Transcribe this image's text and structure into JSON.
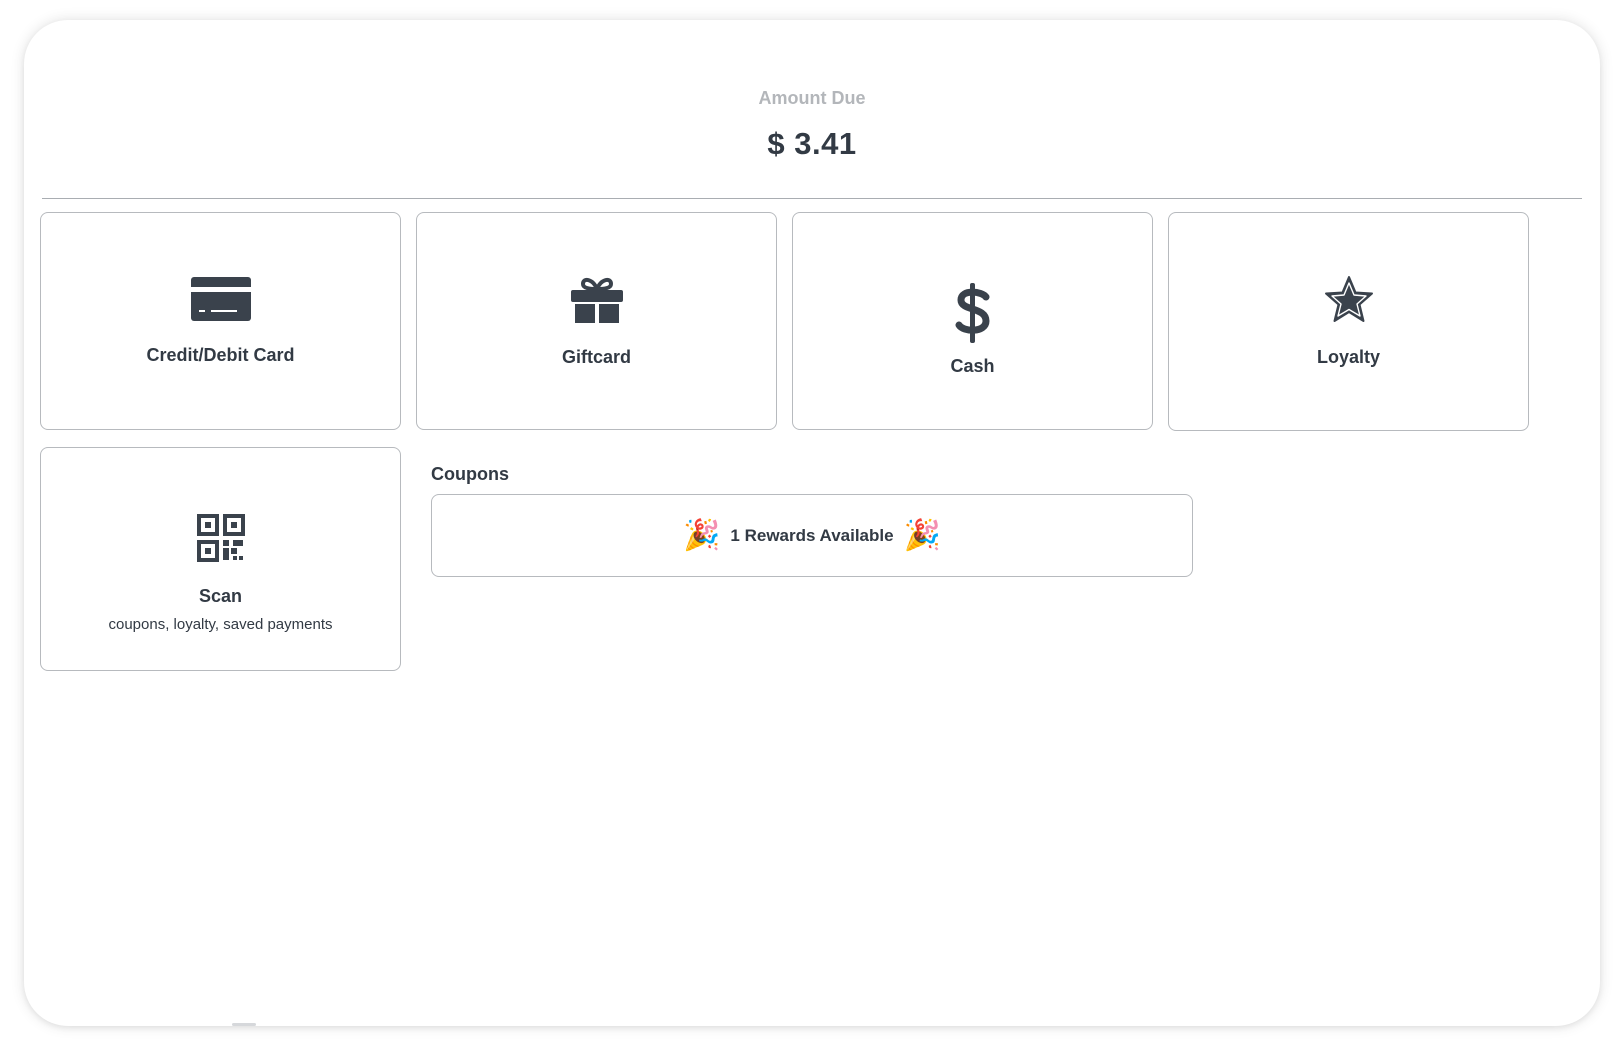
{
  "amount": {
    "label": "Amount Due",
    "value": "$ 3.41"
  },
  "payment_options": [
    {
      "label": "Credit/Debit Card",
      "icon": "credit-card-icon"
    },
    {
      "label": "Giftcard",
      "icon": "gift-icon"
    },
    {
      "label": "Cash",
      "icon": "dollar-icon"
    },
    {
      "label": "Loyalty",
      "icon": "star-icon"
    }
  ],
  "scan": {
    "label": "Scan",
    "sublabel": "coupons, loyalty, saved payments",
    "icon": "qr-code-icon"
  },
  "coupons": {
    "title": "Coupons",
    "rewards_text": "1 Rewards Available",
    "emoji": "🎉"
  },
  "colors": {
    "text": "#323a44",
    "muted": "#b3b6ba",
    "border": "#b7babe",
    "divider": "#a9adb2"
  }
}
